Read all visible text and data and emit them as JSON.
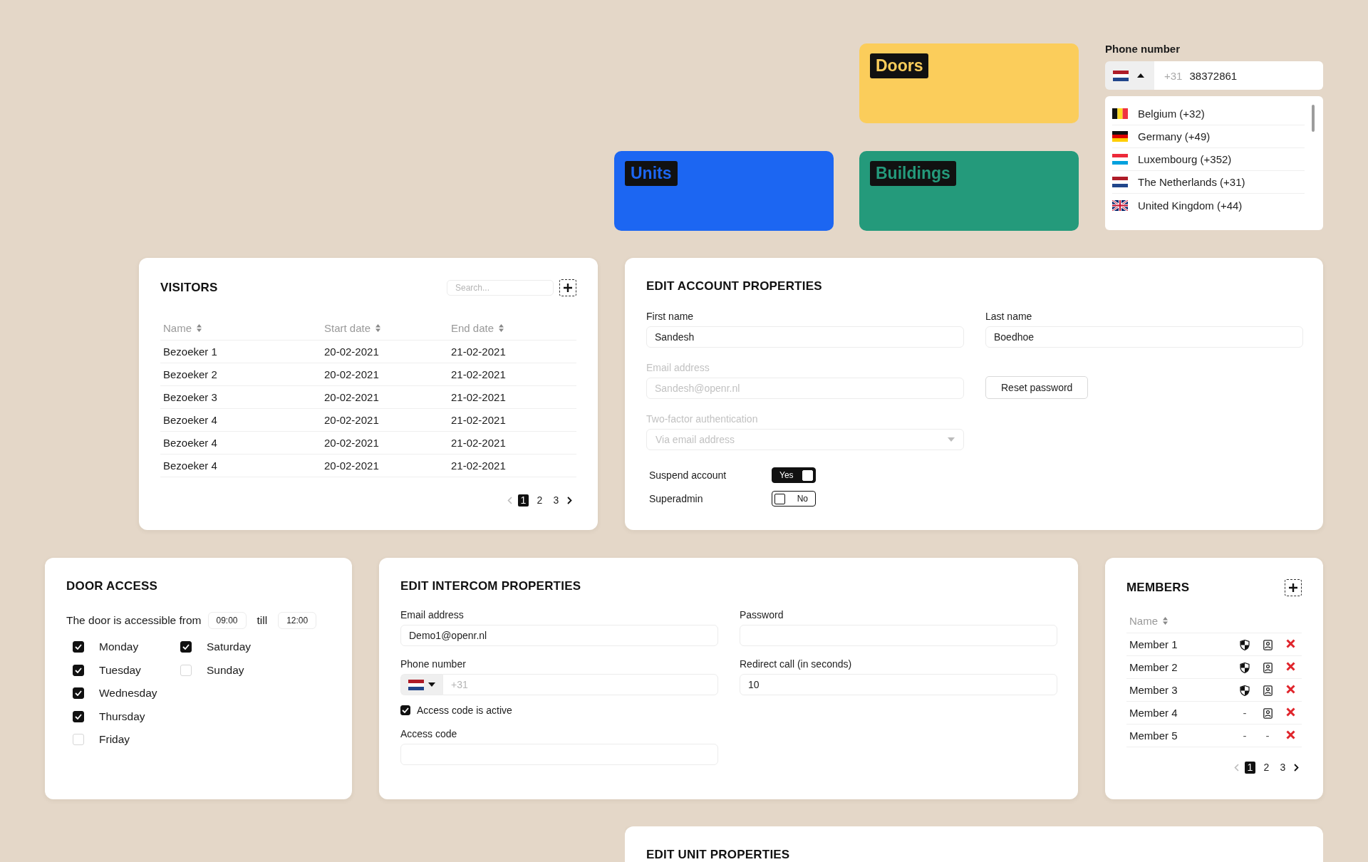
{
  "tiles": [
    {
      "label": "Doors",
      "color": "#fbcd5b"
    },
    {
      "label": "Units",
      "color": "#1c66f2"
    },
    {
      "label": "Buildings",
      "color": "#249a7b"
    }
  ],
  "phone_picker": {
    "label": "Phone number",
    "country": {
      "kind": "nl"
    },
    "expanded": true,
    "prefix": "+31",
    "value": "38372861",
    "countries": [
      {
        "kind": "be",
        "name": "Belgium (+32)"
      },
      {
        "kind": "de",
        "name": "Germany (+49)"
      },
      {
        "kind": "lu",
        "name": "Luxembourg (+352)"
      },
      {
        "kind": "nl",
        "name": "The Netherlands (+31)"
      },
      {
        "kind": "gb",
        "name": "United Kingdom (+44)"
      }
    ]
  },
  "visitors": {
    "title": "VISITORS",
    "search": {
      "placeholder": "Search..."
    },
    "columns": [
      "Name",
      "Start date",
      "End date"
    ],
    "rows": [
      [
        "Bezoeker 1",
        "20-02-2021",
        "21-02-2021"
      ],
      [
        "Bezoeker 2",
        "20-02-2021",
        "21-02-2021"
      ],
      [
        "Bezoeker 3",
        "20-02-2021",
        "21-02-2021"
      ],
      [
        "Bezoeker 4",
        "20-02-2021",
        "21-02-2021"
      ],
      [
        "Bezoeker 4",
        "20-02-2021",
        "21-02-2021"
      ],
      [
        "Bezoeker 4",
        "20-02-2021",
        "21-02-2021"
      ]
    ],
    "pages": [
      {
        "label": "1",
        "selected": true
      },
      {
        "label": "2",
        "selected": false
      },
      {
        "label": "3",
        "selected": false
      }
    ]
  },
  "account": {
    "title": "EDIT ACCOUNT PROPERTIES",
    "fields": [
      {
        "kind": "text",
        "label": "First name",
        "value": "Sandesh",
        "disabled": false
      },
      {
        "kind": "text",
        "label": "Last name",
        "value": "Boedhoe",
        "disabled": false
      },
      {
        "kind": "text",
        "label": "Email address",
        "value": "Sandesh@openr.nl",
        "disabled": true
      },
      {
        "kind": "button",
        "label": "Reset password"
      },
      {
        "kind": "select",
        "label": "Two-factor authentication",
        "value": "Via email address",
        "disabled": true
      }
    ],
    "toggles": [
      {
        "label": "Suspend account",
        "on": true,
        "state_label": "Yes"
      },
      {
        "label": "Superadmin",
        "on": false,
        "state_label": "No"
      }
    ]
  },
  "door_access": {
    "title": "DOOR ACCESS",
    "sentence": "The door is accessible from",
    "from": "09:00",
    "connector": "till",
    "to": "12:00",
    "days": [
      {
        "label": "Monday",
        "checked": true
      },
      {
        "label": "Tuesday",
        "checked": true
      },
      {
        "label": "Wednesday",
        "checked": true
      },
      {
        "label": "Thursday",
        "checked": true
      },
      {
        "label": "Friday",
        "checked": false
      },
      {
        "label": "Saturday",
        "checked": true
      },
      {
        "label": "Sunday",
        "checked": false
      }
    ]
  },
  "intercom": {
    "title": "EDIT INTERCOM PROPERTIES",
    "fields": [
      {
        "kind": "text",
        "label": "Email address",
        "value": "Demo1@openr.nl"
      },
      {
        "kind": "text",
        "label": "Password"
      },
      {
        "kind": "phone",
        "label": "Phone number",
        "country": {
          "kind": "nl"
        },
        "expanded": false,
        "placeholder": "+31"
      },
      {
        "kind": "text",
        "label": "Redirect call (in seconds)",
        "value": "10"
      },
      {
        "kind": "checkbox",
        "label": "Access code is active",
        "checked": true
      },
      {
        "kind": "text",
        "label": "Access code"
      }
    ]
  },
  "members": {
    "title": "MEMBERS",
    "columns": [
      "Name"
    ],
    "none_mark": "-",
    "rows": [
      {
        "name": "Member 1",
        "admin": true,
        "contact": true
      },
      {
        "name": "Member 2",
        "admin": true,
        "contact": true
      },
      {
        "name": "Member 3",
        "admin": true,
        "contact": true
      },
      {
        "name": "Member 4",
        "admin": false,
        "contact": true
      },
      {
        "name": "Member 5",
        "admin": false,
        "contact": false
      }
    ],
    "pages": [
      {
        "label": "1",
        "selected": true
      },
      {
        "label": "2",
        "selected": false
      },
      {
        "label": "3",
        "selected": false
      }
    ]
  },
  "unit": {
    "title": "EDIT UNIT PROPERTIES"
  }
}
